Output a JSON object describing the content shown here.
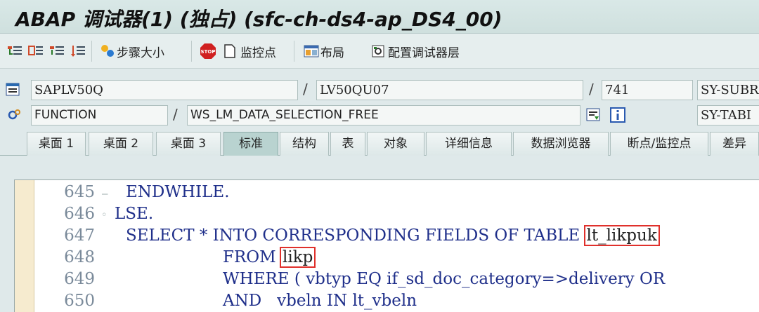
{
  "window": {
    "title": "ABAP 调试器(1) (独占) (sfc-ch-ds4-ap_DS4_00)"
  },
  "toolbar": {
    "step_size_label": "步骤大小",
    "watchpoint_label": "监控点",
    "layout_label": "布局",
    "config_label": "配置调试器层"
  },
  "info": {
    "program": "SAPLV50Q",
    "include": "LV50QU07",
    "line": "741",
    "sy_subrc_label": "SY-SUBR",
    "event_type": "FUNCTION",
    "event_name": "WS_LM_DATA_SELECTION_FREE",
    "sy_tabix_label": "SY-TABI"
  },
  "tabs": [
    "桌面 1",
    "桌面 2",
    "桌面 3",
    "标准",
    "结构",
    "表",
    "对象",
    "详细信息",
    "数据浏览器",
    "断点/监控点",
    "差异"
  ],
  "code": {
    "lines": [
      {
        "no": "645",
        "text": "ENDWHILE."
      },
      {
        "no": "646",
        "text": "LSE."
      },
      {
        "no": "647",
        "pre": "SELECT * INTO CORRESPONDING FIELDS OF TABLE ",
        "boxed": "lt_likpuk"
      },
      {
        "no": "648",
        "pre": "FROM ",
        "boxed": "likp"
      },
      {
        "no": "649",
        "text": "WHERE ( vbtyp EQ if_sd_doc_category=>delivery OR"
      },
      {
        "no": "650",
        "text": "AND   vbeln IN lt_vbeln"
      }
    ]
  }
}
